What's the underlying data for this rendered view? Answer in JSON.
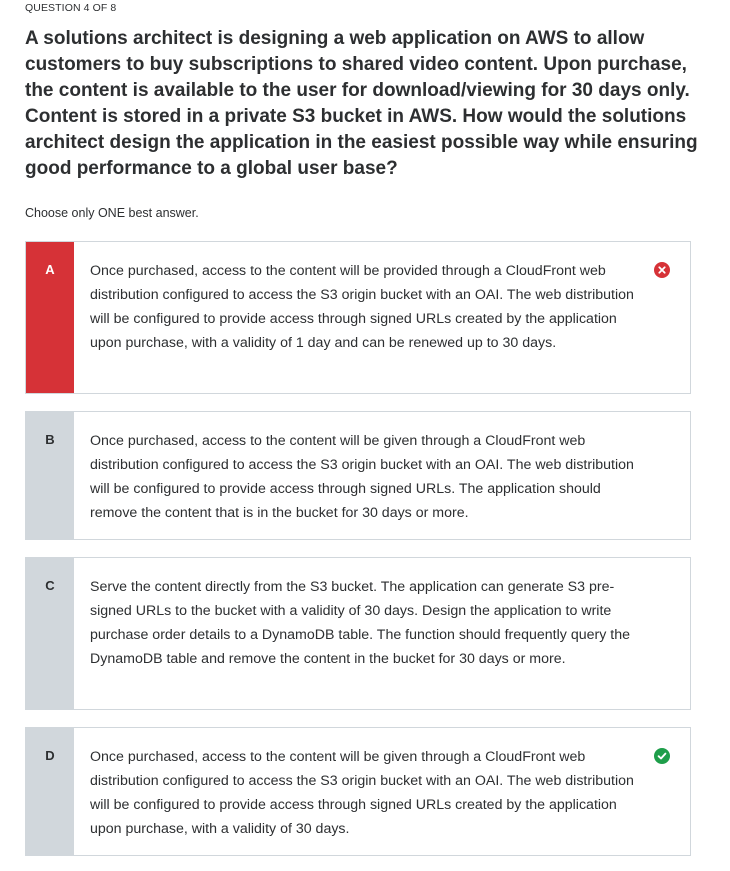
{
  "question": {
    "counter": "QUESTION 4 OF 8",
    "text": "A solutions architect is designing a web application on AWS to allow customers to buy subscriptions to shared video content. Upon purchase, the content is available to the user for download/viewing for 30 days only. Content is stored in a private S3 bucket in AWS. How would the solutions architect design the application in the easiest possible way while ensuring good performance to a global user base?",
    "instruction": "Choose only ONE best answer."
  },
  "options": [
    {
      "letter": "A",
      "text": "Once purchased, access to the content will be provided through a CloudFront web distribution configured to access the S3 origin bucket with an OAI. The web distribution will be configured to provide access through signed URLs created by the application upon purchase, with a validity of 1 day and can be renewed up to 30 days.",
      "status": "incorrect",
      "status_icon": "x-circle-icon"
    },
    {
      "letter": "B",
      "text": "Once purchased, access to the content will be given through a CloudFront web distribution configured to access the S3 origin bucket with an OAI. The web distribution will be configured to provide access through signed URLs. The application should remove the content that is in the bucket for 30 days or more.",
      "status": "none"
    },
    {
      "letter": "C",
      "text": "Serve the content directly from the S3 bucket. The application can generate S3 pre-signed URLs to the bucket with a validity of 30 days. Design the application to write purchase order details to a DynamoDB table. The function should frequently query the DynamoDB table and remove the content in the bucket for 30 days or more.",
      "status": "none"
    },
    {
      "letter": "D",
      "text": "Once purchased, access to the content will be given through a CloudFront web distribution configured to access the S3 origin bucket with an OAI. The web distribution will be configured to provide access through signed URLs created by the application upon purchase, with a validity of 30 days.",
      "status": "correct",
      "status_icon": "check-circle-icon"
    }
  ],
  "colors": {
    "incorrect": "#d63237",
    "correct": "#1e9e4a",
    "neutral_bar": "#d1d7dc",
    "border": "#d1d7dc",
    "text": "#2d2f31"
  }
}
